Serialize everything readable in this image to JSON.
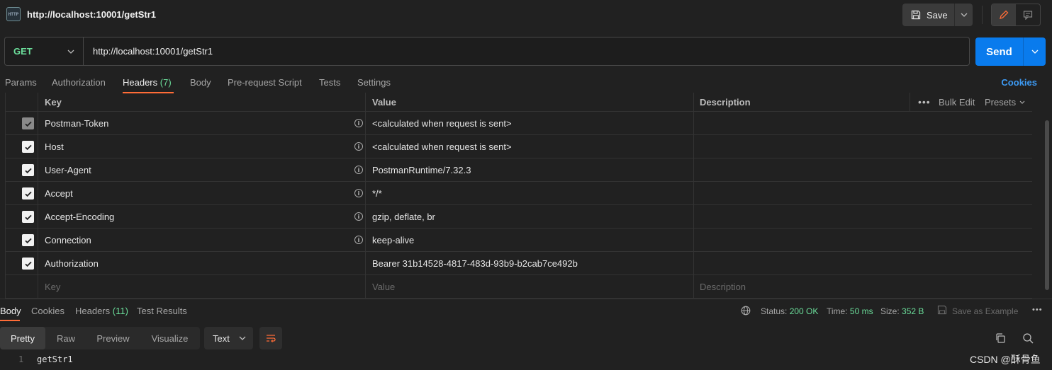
{
  "request": {
    "title": "http://localhost:10001/getStr1",
    "icon_text": "HTTP",
    "save_label": "Save",
    "method": "GET",
    "url": "http://localhost:10001/getStr1",
    "send_label": "Send"
  },
  "tabs": [
    {
      "label": "Params"
    },
    {
      "label": "Authorization"
    },
    {
      "label": "Headers",
      "count": "(7)"
    },
    {
      "label": "Body"
    },
    {
      "label": "Pre-request Script"
    },
    {
      "label": "Tests"
    },
    {
      "label": "Settings"
    }
  ],
  "cookies_label": "Cookies",
  "headers_table": {
    "columns": {
      "key": "Key",
      "value": "Value",
      "description": "Description"
    },
    "bulk_edit": "Bulk Edit",
    "presets": "Presets",
    "rows": [
      {
        "key": "Postman-Token",
        "value": "<calculated when request is sent>",
        "checked": true,
        "disabled": true,
        "info": true
      },
      {
        "key": "Host",
        "value": "<calculated when request is sent>",
        "checked": true,
        "disabled": false,
        "info": true
      },
      {
        "key": "User-Agent",
        "value": "PostmanRuntime/7.32.3",
        "checked": true,
        "disabled": false,
        "info": true
      },
      {
        "key": "Accept",
        "value": "*/*",
        "checked": true,
        "disabled": false,
        "info": true
      },
      {
        "key": "Accept-Encoding",
        "value": "gzip, deflate, br",
        "checked": true,
        "disabled": false,
        "info": true
      },
      {
        "key": "Connection",
        "value": "keep-alive",
        "checked": true,
        "disabled": false,
        "info": true
      },
      {
        "key": "Authorization",
        "value": "Bearer 31b14528-4817-483d-93b9-b2cab7ce492b",
        "checked": true,
        "disabled": false,
        "info": false
      }
    ],
    "placeholders": {
      "key": "Key",
      "value": "Value",
      "description": "Description"
    }
  },
  "response": {
    "tabs": [
      {
        "label": "Body"
      },
      {
        "label": "Cookies"
      },
      {
        "label": "Headers",
        "count": "(11)"
      },
      {
        "label": "Test Results"
      }
    ],
    "status_label": "Status:",
    "status_value": "200 OK",
    "time_label": "Time:",
    "time_value": "50 ms",
    "size_label": "Size:",
    "size_value": "352 B",
    "save_example": "Save as Example",
    "views": [
      "Pretty",
      "Raw",
      "Preview",
      "Visualize"
    ],
    "format": "Text",
    "line_number": "1",
    "body_text": "getStr1"
  },
  "watermark": "CSDN @酥骨鱼",
  "colors": {
    "accent_orange": "#ff6c37",
    "send_blue": "#097bed",
    "success_green": "#6bdd9a",
    "link_blue": "#3d9bf5"
  }
}
